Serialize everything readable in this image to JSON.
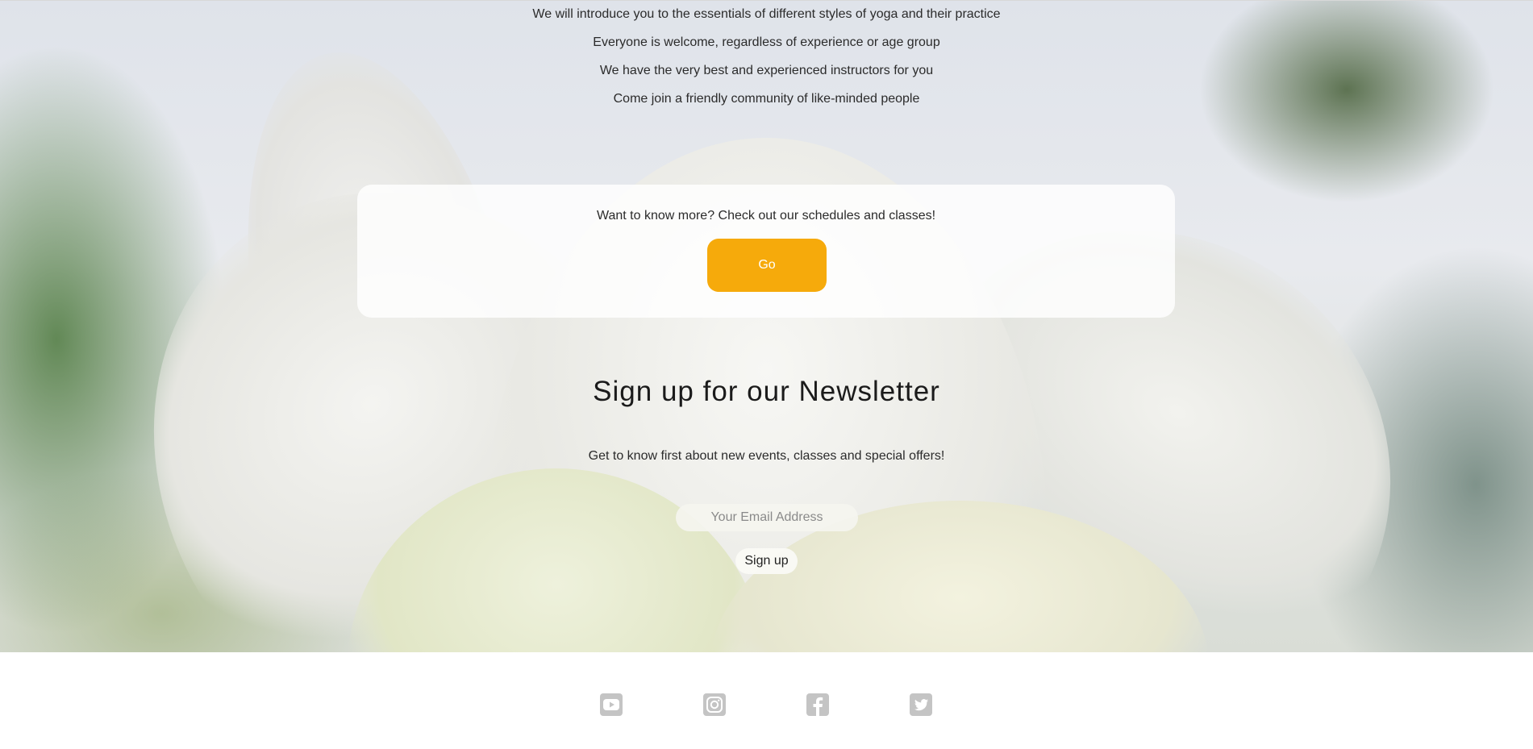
{
  "intro": {
    "lines": [
      "We will introduce you to the essentials of different styles of yoga and their practice",
      "Everyone is welcome, regardless of experience or age group",
      "We have the very best and experienced instructors for you",
      "Come join a friendly community of like-minded people"
    ]
  },
  "cta": {
    "text": "Want to know more? Check out our schedules and classes!",
    "button_label": "Go",
    "button_color": "#f6aa0b"
  },
  "newsletter": {
    "title": "Sign up for our Newsletter",
    "subtitle": "Get to know first about new events, classes and special offers!",
    "email_placeholder": "Your Email Address",
    "signup_label": "Sign up"
  },
  "footer": {
    "social_icons": [
      "youtube-icon",
      "instagram-icon",
      "facebook-icon",
      "twitter-icon"
    ],
    "icon_color": "#c4c4c4"
  }
}
